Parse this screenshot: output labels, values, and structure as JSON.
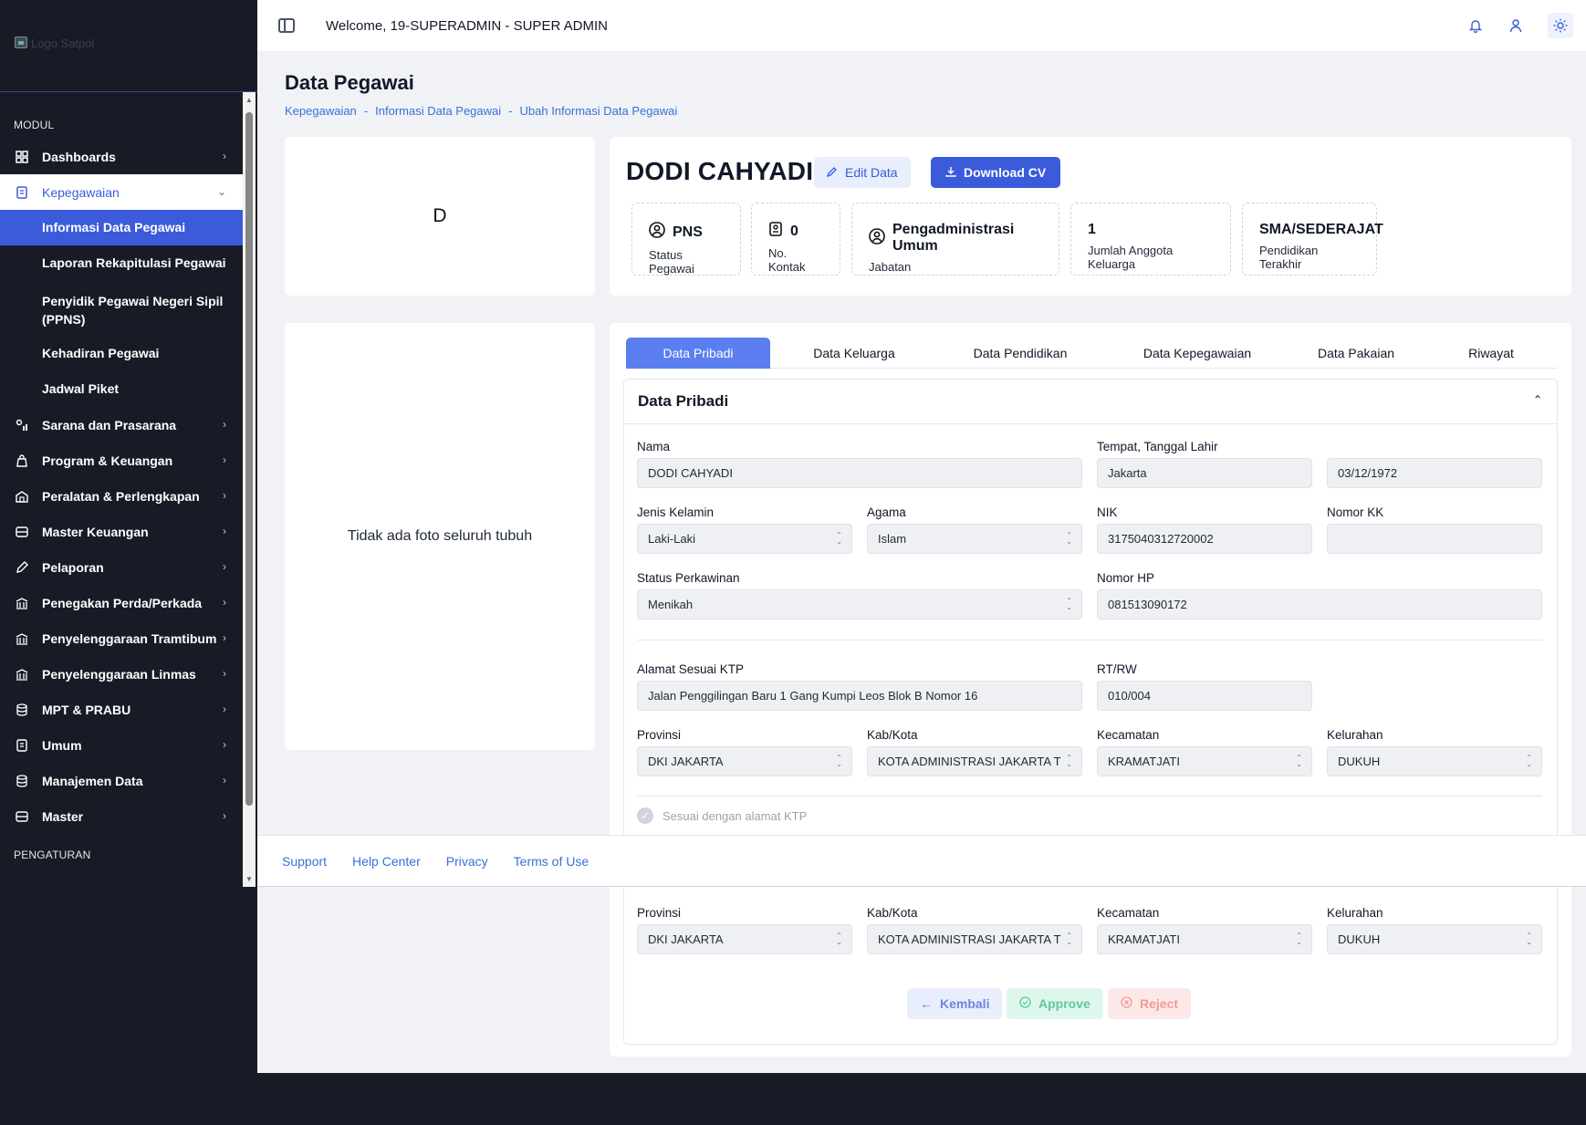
{
  "sidebar": {
    "logo_alt": "Logo Satpol",
    "section_modul": "MODUL",
    "section_pengaturan": "PENGATURAN",
    "items": [
      {
        "label": "Dashboards"
      },
      {
        "label": "Kepegawaian"
      },
      {
        "label": "Sarana dan Prasarana"
      },
      {
        "label": "Program & Keuangan"
      },
      {
        "label": "Peralatan & Perlengkapan"
      },
      {
        "label": "Master Keuangan"
      },
      {
        "label": "Pelaporan"
      },
      {
        "label": "Penegakan Perda/Perkada"
      },
      {
        "label": "Penyelenggaraan Tramtibum"
      },
      {
        "label": "Penyelenggaraan Linmas"
      },
      {
        "label": "MPT & PRABU"
      },
      {
        "label": "Umum"
      },
      {
        "label": "Manajemen Data"
      },
      {
        "label": "Master"
      }
    ],
    "sub_items": [
      {
        "label": "Informasi Data Pegawai"
      },
      {
        "label": "Laporan Rekapitulasi Pegawai"
      },
      {
        "label": "Penyidik Pegawai Negeri Sipil (PPNS)"
      },
      {
        "label": "Kehadiran Pegawai"
      },
      {
        "label": "Jadwal Piket"
      }
    ]
  },
  "topbar": {
    "welcome": "Welcome, 19-SUPERADMIN - SUPER ADMIN"
  },
  "page": {
    "title": "Data Pegawai",
    "breadcrumb": [
      "Kepegawaian",
      "Informasi Data Pegawai",
      "Ubah Informasi Data Pegawai"
    ],
    "breadcrumb_sep": "-"
  },
  "avatar": {
    "initial": "D"
  },
  "body_photo": {
    "empty_text": "Tidak ada foto seluruh tubuh"
  },
  "profile": {
    "name": "DODI CAHYADI",
    "edit_label": "Edit Data",
    "download_label": "Download CV",
    "stats": [
      {
        "value": "PNS",
        "label": "Status Pegawai"
      },
      {
        "value": "0",
        "label": "No. Kontak"
      },
      {
        "value": "Pengadministrasi Umum",
        "label": "Jabatan"
      },
      {
        "value": "1",
        "label": "Jumlah Anggota Keluarga"
      },
      {
        "value": "SMA/SEDERAJAT",
        "label": "Pendidikan Terakhir"
      }
    ]
  },
  "tabs": [
    "Data Pribadi",
    "Data Keluarga",
    "Data Pendidikan",
    "Data Kepegawaian",
    "Data Pakaian",
    "Riwayat"
  ],
  "form": {
    "section_title": "Data Pribadi",
    "nama_label": "Nama",
    "nama": "DODI CAHYADI",
    "ttl_label": "Tempat, Tanggal Lahir",
    "tempat": "Jakarta",
    "tanggal": "03/12/1972",
    "jk_label": "Jenis Kelamin",
    "jk": "Laki-Laki",
    "agama_label": "Agama",
    "agama": "Islam",
    "nik_label": "NIK",
    "nik": "3175040312720002",
    "kk_label": "Nomor KK",
    "kk": "",
    "kawin_label": "Status Perkawinan",
    "kawin": "Menikah",
    "hp_label": "Nomor HP",
    "hp": "081513090172",
    "alamat_label": "Alamat Sesuai KTP",
    "alamat": "Jalan Penggilingan Baru 1 Gang Kumpi Leos Blok B Nomor 16",
    "rtrw_label": "RT/RW",
    "rtrw": "010/004",
    "prov_label": "Provinsi",
    "prov": "DKI JAKARTA",
    "kab_label": "Kab/Kota",
    "kab": "KOTA ADMINISTRASI JAKARTA T",
    "kec_label": "Kecamatan",
    "kec": "KRAMATJATI",
    "kel_label": "Kelurahan",
    "kel": "DUKUH",
    "sesuai_label": "Sesuai dengan alamat KTP"
  },
  "actions": {
    "back": "Kembali",
    "approve": "Approve",
    "reject": "Reject"
  },
  "footer": {
    "links": [
      "Support",
      "Help Center",
      "Privacy",
      "Terms of Use"
    ]
  },
  "colors": {
    "primary": "#3b5bdb",
    "sidebar_bg": "#181a26",
    "approve": "#5fc99a",
    "reject": "#f29a9a"
  }
}
